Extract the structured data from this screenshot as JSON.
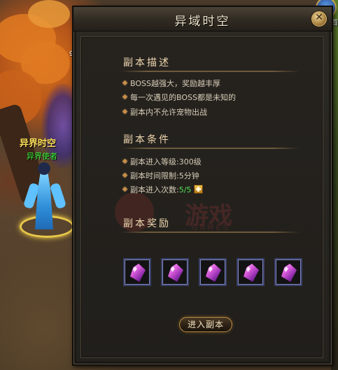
{
  "npc": {
    "name": "异界时空",
    "title": "异界使者"
  },
  "hud": {
    "left_number": "9",
    "right_text": "首"
  },
  "dialog": {
    "title": "异域时空",
    "close_label": "✕",
    "sections": {
      "description": {
        "title": "副本描述",
        "items": [
          "BOSS越强大，奖励越丰厚",
          "每一次遇见的BOSS都是未知的",
          "副本内不允许宠物出战"
        ]
      },
      "conditions": {
        "title": "副本条件",
        "level_req": "副本进入等级:300级",
        "time_limit": "副本时间限制:5分钟",
        "entry_count_label": "副本进入次数:",
        "entry_count_value": "5/5"
      },
      "rewards": {
        "title": "副本奖励",
        "items": [
          "purple-gem",
          "purple-gem",
          "purple-gem",
          "purple-gem",
          "purple-gem"
        ]
      }
    },
    "enter_button": "进入副本"
  },
  "watermark": {
    "brand": "游戏",
    "sub": "GAMES"
  },
  "colors": {
    "accent_gold": "#c89a4e",
    "title_text": "#efe6cc",
    "count_green": "#4fe04f",
    "npc_name": "#ffe05a",
    "npc_title": "#3df23d"
  }
}
